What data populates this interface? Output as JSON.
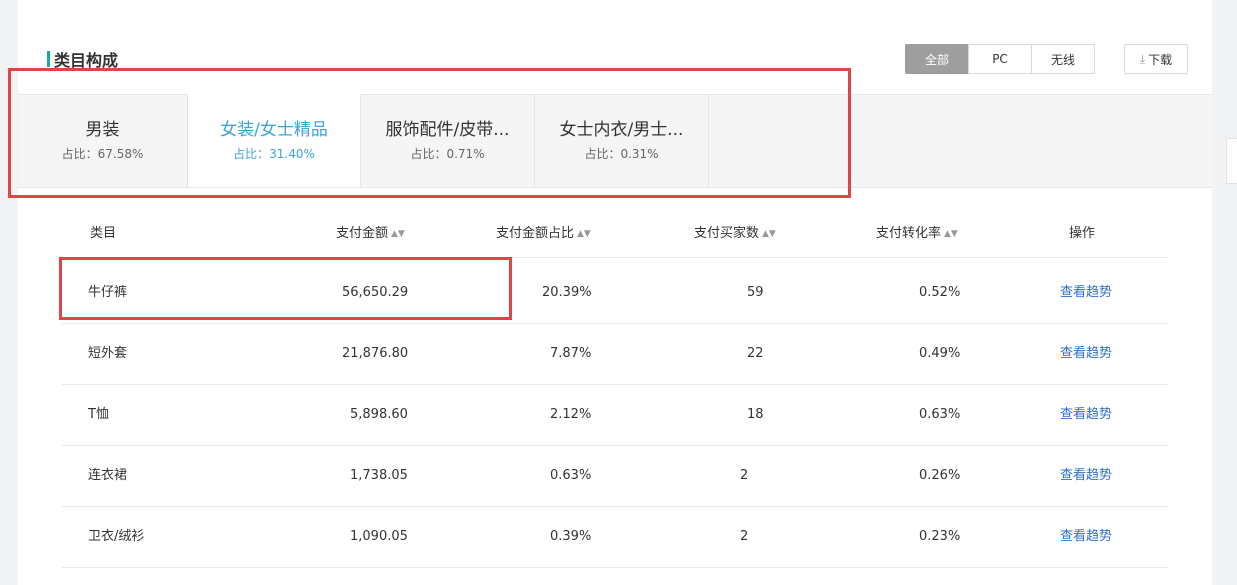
{
  "section": {
    "title": "类目构成"
  },
  "filters": {
    "all": "全部",
    "pc": "PC",
    "wireless": "无线",
    "active": "全部"
  },
  "download": {
    "label": "下载",
    "icon": "download-icon"
  },
  "tabs": [
    {
      "name": "男装",
      "share": "占比：67.58%",
      "active": false
    },
    {
      "name": "女装/女士精品",
      "share": "占比：31.40%",
      "active": true
    },
    {
      "name": "服饰配件/皮带...",
      "share": "占比：0.71%",
      "active": false
    },
    {
      "name": "女士内衣/男士...",
      "share": "占比：0.31%",
      "active": false
    }
  ],
  "table": {
    "headers": {
      "category": "类目",
      "pay_amount": "支付金额",
      "pay_ratio": "支付金额占比",
      "buyers": "支付买家数",
      "conversion": "支付转化率",
      "action": "操作"
    },
    "rows": [
      {
        "category": "牛仔裤",
        "pay_amount": "56,650.29",
        "pay_ratio": "20.39%",
        "buyers": "59",
        "conversion": "0.52%",
        "action": "查看趋势"
      },
      {
        "category": "短外套",
        "pay_amount": "21,876.80",
        "pay_ratio": "7.87%",
        "buyers": "22",
        "conversion": "0.49%",
        "action": "查看趋势"
      },
      {
        "category": "T恤",
        "pay_amount": "5,898.60",
        "pay_ratio": "2.12%",
        "buyers": "18",
        "conversion": "0.63%",
        "action": "查看趋势"
      },
      {
        "category": "连衣裙",
        "pay_amount": "1,738.05",
        "pay_ratio": "0.63%",
        "buyers": "2",
        "conversion": "0.26%",
        "action": "查看趋势"
      },
      {
        "category": "卫衣/绒衫",
        "pay_amount": "1,090.05",
        "pay_ratio": "0.39%",
        "buyers": "2",
        "conversion": "0.23%",
        "action": "查看趋势"
      }
    ]
  },
  "colors": {
    "accent": "#1aa9a5",
    "active_tab": "#3ea3dc",
    "link": "#2f6fca",
    "highlight": "#e04545"
  }
}
